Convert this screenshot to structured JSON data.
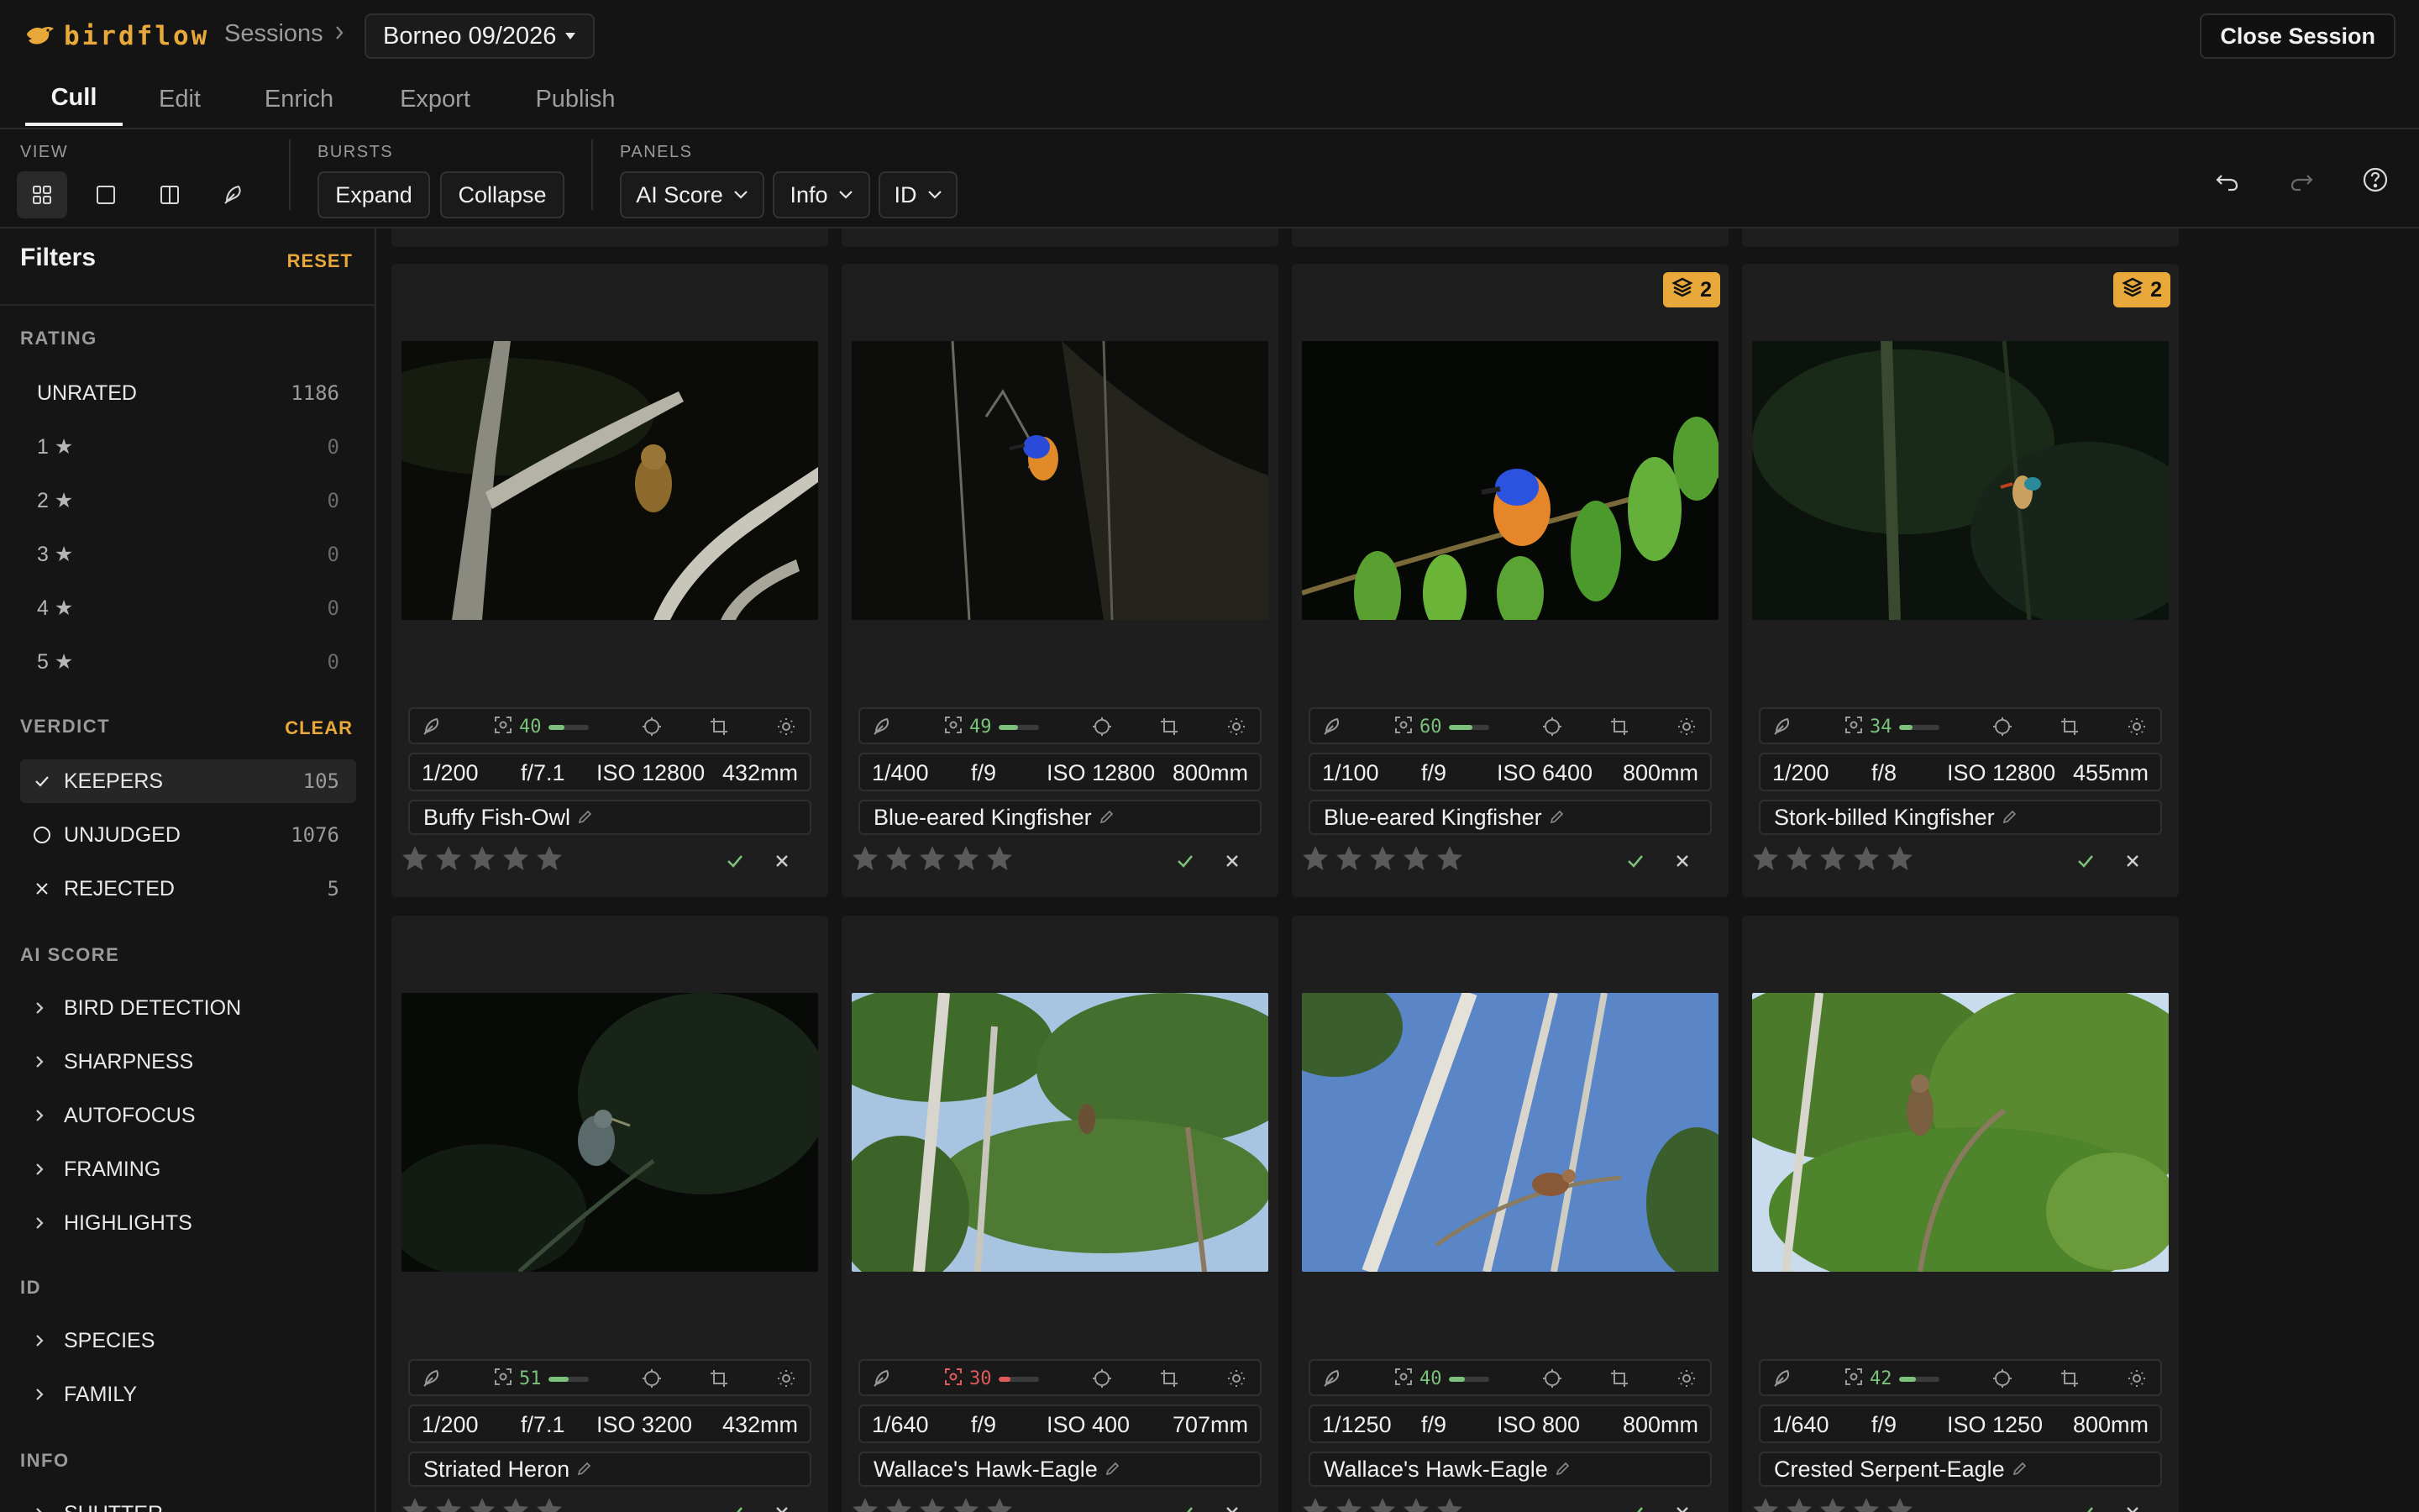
{
  "app": {
    "name": "birdflow"
  },
  "breadcrumb": {
    "sessions": "Sessions",
    "current": "Borneo 09/2026"
  },
  "header": {
    "close_session": "Close Session"
  },
  "tabs": [
    {
      "label": "Cull",
      "active": true
    },
    {
      "label": "Edit",
      "active": false
    },
    {
      "label": "Enrich",
      "active": false
    },
    {
      "label": "Export",
      "active": false
    },
    {
      "label": "Publish",
      "active": false
    }
  ],
  "toolbar": {
    "view_label": "VIEW",
    "view_buttons": [
      "grid-view-icon",
      "single-view-icon",
      "compare-view-icon",
      "bird-view-icon"
    ],
    "bursts_label": "BURSTS",
    "expand": "Expand",
    "collapse": "Collapse",
    "panels_label": "PANELS",
    "panels": [
      "AI Score",
      "Info",
      "ID"
    ],
    "right_icons": [
      "undo-icon",
      "redo-icon",
      "help-icon"
    ]
  },
  "sidebar": {
    "title": "Filters",
    "reset": "RESET",
    "rating": {
      "label": "RATING",
      "rows": [
        {
          "label": "UNRATED",
          "count": "1186"
        },
        {
          "label": "1 ★",
          "count": "0"
        },
        {
          "label": "2 ★",
          "count": "0"
        },
        {
          "label": "3 ★",
          "count": "0"
        },
        {
          "label": "4 ★",
          "count": "0"
        },
        {
          "label": "5 ★",
          "count": "0"
        }
      ]
    },
    "verdict": {
      "label": "VERDICT",
      "clear": "CLEAR",
      "rows": [
        {
          "label": "KEEPERS",
          "count": "105",
          "selected": true
        },
        {
          "label": "UNJUDGED",
          "count": "1076",
          "selected": false
        },
        {
          "label": "REJECTED",
          "count": "5",
          "selected": false
        }
      ]
    },
    "ai_score": {
      "label": "AI SCORE",
      "rows": [
        "BIRD DETECTION",
        "SHARPNESS",
        "AUTOFOCUS",
        "FRAMING",
        "HIGHLIGHTS"
      ]
    },
    "id": {
      "label": "ID",
      "rows": [
        "SPECIES",
        "FAMILY"
      ]
    },
    "info": {
      "label": "INFO",
      "rows": [
        "SHUTTER"
      ]
    }
  },
  "photos": [
    {
      "score": "40",
      "score_fraction": 0.4,
      "shutter": "1/200",
      "aperture": "f/7.1",
      "iso": "ISO 12800",
      "focal": "432mm",
      "species": "Buffy Fish-Owl",
      "burst": null,
      "scene": "night-owl"
    },
    {
      "score": "49",
      "score_fraction": 0.49,
      "shutter": "1/400",
      "aperture": "f/9",
      "iso": "ISO 12800",
      "focal": "800mm",
      "species": "Blue-eared Kingfisher",
      "burst": null,
      "scene": "night-kingfisher"
    },
    {
      "score": "60",
      "score_fraction": 0.6,
      "shutter": "1/100",
      "aperture": "f/9",
      "iso": "ISO 6400",
      "focal": "800mm",
      "species": "Blue-eared Kingfisher",
      "burst": "2",
      "scene": "leaf-kingfisher"
    },
    {
      "score": "34",
      "score_fraction": 0.34,
      "shutter": "1/200",
      "aperture": "f/8",
      "iso": "ISO 12800",
      "focal": "455mm",
      "species": "Stork-billed Kingfisher",
      "burst": "2",
      "scene": "dark-forest"
    },
    {
      "score": "51",
      "score_fraction": 0.51,
      "shutter": "1/200",
      "aperture": "f/7.1",
      "iso": "ISO 3200",
      "focal": "432mm",
      "species": "Striated Heron",
      "burst": null,
      "scene": "dark-heron"
    },
    {
      "score": "30",
      "score_fraction": 0.3,
      "low": true,
      "shutter": "1/640",
      "aperture": "f/9",
      "iso": "ISO 400",
      "focal": "707mm",
      "species": "Wallace's Hawk-Eagle",
      "burst": null,
      "scene": "canopy"
    },
    {
      "score": "40",
      "score_fraction": 0.4,
      "shutter": "1/1250",
      "aperture": "f/9",
      "iso": "ISO 800",
      "focal": "800mm",
      "species": "Wallace's Hawk-Eagle",
      "burst": null,
      "scene": "blue-sky"
    },
    {
      "score": "42",
      "score_fraction": 0.42,
      "shutter": "1/640",
      "aperture": "f/9",
      "iso": "ISO 1250",
      "focal": "800mm",
      "species": "Crested Serpent-Eagle",
      "burst": null,
      "scene": "green-tree"
    }
  ],
  "colors": {
    "accent": "#e8a93a",
    "score_good": "#7bc07b",
    "score_low": "#e05a5a"
  }
}
